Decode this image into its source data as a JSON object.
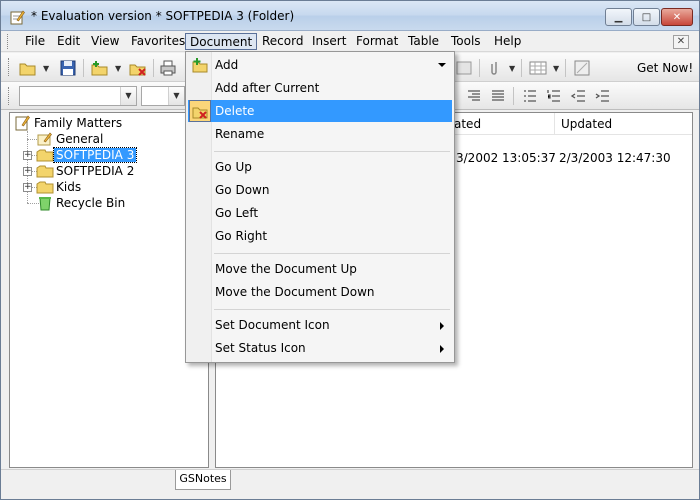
{
  "window": {
    "title": "* Evaluation version * SOFTPEDIA 3 (Folder)",
    "controls": {
      "minimize": "▁",
      "maximize": "□",
      "close": "✕"
    }
  },
  "menubar": {
    "items": [
      "File",
      "Edit",
      "View",
      "Favorites",
      "Document",
      "Record",
      "Insert",
      "Format",
      "Table",
      "Tools",
      "Help"
    ],
    "active": "Document",
    "mdi_close": "✕"
  },
  "toolbar": {
    "get_now": "Get Now!"
  },
  "tree": {
    "root": "Family Matters",
    "items": [
      {
        "label": "General"
      },
      {
        "label": "SOFTPEDIA 3",
        "selected": true
      },
      {
        "label": "SOFTPEDIA 2"
      },
      {
        "label": "Kids"
      },
      {
        "label": "Recycle Bin"
      }
    ]
  },
  "list": {
    "columns": [
      "ated",
      "Updated"
    ],
    "rows": [
      {
        "created": "3/2002 13:05:37",
        "updated": "2/3/2003 12:47:30"
      }
    ]
  },
  "bottom_tab": "GSNotes",
  "document_menu": {
    "items": [
      {
        "label": "Add",
        "icon": "add-document-icon",
        "submenu_down": true
      },
      {
        "label": "Add after Current"
      },
      {
        "label": "Delete",
        "icon": "delete-document-icon",
        "highlighted": true
      },
      {
        "label": "Rename"
      },
      {
        "separator": true
      },
      {
        "label": "Go Up"
      },
      {
        "label": "Go Down"
      },
      {
        "label": "Go Left"
      },
      {
        "label": "Go Right"
      },
      {
        "separator": true
      },
      {
        "label": "Move the Document Up"
      },
      {
        "label": "Move the Document Down"
      },
      {
        "separator": true
      },
      {
        "label": "Set Document Icon",
        "submenu": true
      },
      {
        "label": "Set Status Icon",
        "submenu": true
      }
    ]
  },
  "colors": {
    "highlight": "#3399ff",
    "folder": "#f3d46b",
    "selection_text": "#ffffff"
  }
}
